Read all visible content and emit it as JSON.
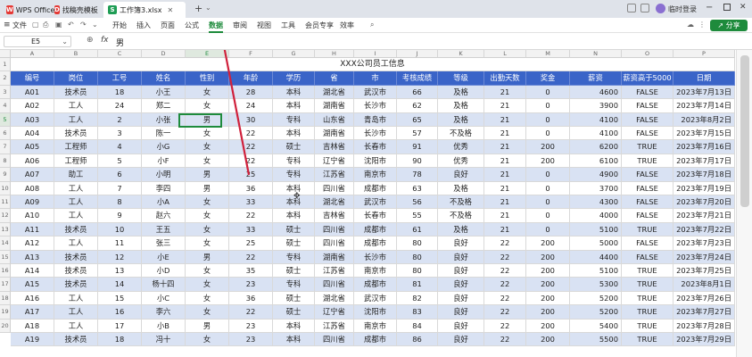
{
  "titlebar": {
    "tabs": [
      {
        "label": "WPS Office",
        "icon": "wps-logo-icon",
        "color": "#e53935"
      },
      {
        "label": "找稿壳模板",
        "icon": "template-icon",
        "color": "#e53935"
      },
      {
        "label": "工作簿3.xlsx",
        "icon": "sheet-icon",
        "color": "#1f9d55"
      }
    ],
    "new_tab": "+",
    "login": "临时登录"
  },
  "ribbon": {
    "file_menu": "文件",
    "tabs": [
      "开始",
      "插入",
      "页面",
      "公式",
      "数据",
      "审阅",
      "视图",
      "工具",
      "会员专享",
      "效率"
    ],
    "active_tab": "数据",
    "share": "分享"
  },
  "formula_bar": {
    "cell_ref": "E5",
    "fx": "fx",
    "value": "男"
  },
  "columns": [
    "A",
    "B",
    "C",
    "D",
    "E",
    "F",
    "G",
    "H",
    "I",
    "J",
    "K",
    "L",
    "M",
    "N",
    "O",
    "P"
  ],
  "rows": [
    "1",
    "2",
    "3",
    "4",
    "5",
    "6",
    "7",
    "8",
    "9",
    "10",
    "11",
    "12",
    "13",
    "14",
    "15",
    "16",
    "17",
    "18",
    "19",
    "20"
  ],
  "sheet": {
    "title": "XXX公司员工信息",
    "headers": [
      "编号",
      "岗位",
      "工号",
      "姓名",
      "性别",
      "年龄",
      "学历",
      "省",
      "市",
      "考核成绩",
      "等级",
      "出勤天数",
      "奖金",
      "薪资",
      "薪资高于5000",
      "日期"
    ],
    "data": [
      [
        "A01",
        "技术员",
        "18",
        "小王",
        "女",
        "28",
        "本科",
        "湖北省",
        "武汉市",
        "66",
        "及格",
        "21",
        "0",
        "4600",
        "FALSE",
        "2023年7月13日"
      ],
      [
        "A02",
        "工人",
        "24",
        "郑二",
        "女",
        "24",
        "本科",
        "湖南省",
        "长沙市",
        "62",
        "及格",
        "21",
        "0",
        "3900",
        "FALSE",
        "2023年7月14日"
      ],
      [
        "A03",
        "工人",
        "2",
        "小张",
        "男",
        "30",
        "专科",
        "山东省",
        "青岛市",
        "65",
        "及格",
        "21",
        "0",
        "4100",
        "FALSE",
        "2023年8月2日"
      ],
      [
        "A04",
        "技术员",
        "3",
        "陈一",
        "女",
        "22",
        "本科",
        "湖南省",
        "长沙市",
        "57",
        "不及格",
        "21",
        "0",
        "4100",
        "FALSE",
        "2023年7月15日"
      ],
      [
        "A05",
        "工程师",
        "4",
        "小G",
        "女",
        "22",
        "硕士",
        "吉林省",
        "长春市",
        "91",
        "优秀",
        "21",
        "200",
        "6200",
        "TRUE",
        "2023年7月16日"
      ],
      [
        "A06",
        "工程师",
        "5",
        "小F",
        "女",
        "22",
        "专科",
        "辽宁省",
        "沈阳市",
        "90",
        "优秀",
        "21",
        "200",
        "6100",
        "TRUE",
        "2023年7月17日"
      ],
      [
        "A07",
        "助工",
        "6",
        "小明",
        "男",
        "25",
        "专科",
        "江苏省",
        "南京市",
        "78",
        "良好",
        "21",
        "0",
        "4900",
        "FALSE",
        "2023年7月18日"
      ],
      [
        "A08",
        "工人",
        "7",
        "李四",
        "男",
        "36",
        "本科",
        "四川省",
        "成都市",
        "63",
        "及格",
        "21",
        "0",
        "3700",
        "FALSE",
        "2023年7月19日"
      ],
      [
        "A09",
        "工人",
        "8",
        "小A",
        "女",
        "33",
        "本科",
        "湖北省",
        "武汉市",
        "56",
        "不及格",
        "21",
        "0",
        "4300",
        "FALSE",
        "2023年7月20日"
      ],
      [
        "A10",
        "工人",
        "9",
        "赵六",
        "女",
        "22",
        "本科",
        "吉林省",
        "长春市",
        "55",
        "不及格",
        "21",
        "0",
        "4000",
        "FALSE",
        "2023年7月21日"
      ],
      [
        "A11",
        "技术员",
        "10",
        "王五",
        "女",
        "33",
        "硕士",
        "四川省",
        "成都市",
        "61",
        "及格",
        "21",
        "0",
        "5100",
        "TRUE",
        "2023年7月22日"
      ],
      [
        "A12",
        "工人",
        "11",
        "张三",
        "女",
        "25",
        "硕士",
        "四川省",
        "成都市",
        "80",
        "良好",
        "22",
        "200",
        "5000",
        "FALSE",
        "2023年7月23日"
      ],
      [
        "A13",
        "技术员",
        "12",
        "小E",
        "男",
        "22",
        "专科",
        "湖南省",
        "长沙市",
        "80",
        "良好",
        "22",
        "200",
        "4400",
        "FALSE",
        "2023年7月24日"
      ],
      [
        "A14",
        "技术员",
        "13",
        "小D",
        "女",
        "35",
        "硕士",
        "江苏省",
        "南京市",
        "80",
        "良好",
        "22",
        "200",
        "5100",
        "TRUE",
        "2023年7月25日"
      ],
      [
        "A15",
        "技术员",
        "14",
        "杨十四",
        "女",
        "23",
        "专科",
        "四川省",
        "成都市",
        "81",
        "良好",
        "22",
        "200",
        "5300",
        "TRUE",
        "2023年8月1日"
      ],
      [
        "A16",
        "工人",
        "15",
        "小C",
        "女",
        "36",
        "硕士",
        "湖北省",
        "武汉市",
        "82",
        "良好",
        "22",
        "200",
        "5200",
        "TRUE",
        "2023年7月26日"
      ],
      [
        "A17",
        "工人",
        "16",
        "李六",
        "女",
        "22",
        "硕士",
        "辽宁省",
        "沈阳市",
        "83",
        "良好",
        "22",
        "200",
        "5200",
        "TRUE",
        "2023年7月27日"
      ],
      [
        "A18",
        "工人",
        "17",
        "小B",
        "男",
        "23",
        "本科",
        "江苏省",
        "南京市",
        "84",
        "良好",
        "22",
        "200",
        "5400",
        "TRUE",
        "2023年7月28日"
      ],
      [
        "A19",
        "技术员",
        "18",
        "冯十",
        "女",
        "23",
        "本科",
        "四川省",
        "成都市",
        "86",
        "良好",
        "22",
        "200",
        "5500",
        "TRUE",
        "2023年7月29日"
      ]
    ]
  },
  "colors": {
    "header_bg": "#3a64c8",
    "band_bg": "#d9e2f3",
    "selection": "#1e8b3c",
    "arrow": "#d0213c"
  }
}
